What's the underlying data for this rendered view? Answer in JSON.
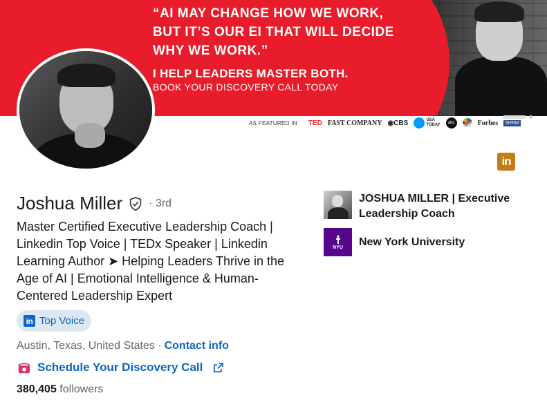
{
  "banner": {
    "quote_lines": [
      "“AI MAY CHANGE HOW WE WORK,",
      "BUT IT’S OUR EI THAT WILL DECIDE",
      "WHY WE WORK.”"
    ],
    "pitch": "I HELP LEADERS MASTER BOTH.",
    "cta": "BOOK YOUR DISCOVERY CALL TODAY",
    "featured_label": "AS FEATURED IN",
    "logos": {
      "ted": "TED",
      "fast_company": "FAST COMPANY",
      "cbs": "CBS",
      "usa_today_line1": "USA",
      "usa_today_line2": "TODAY",
      "abc": "abc",
      "nbc": "NBC",
      "forbes": "Forbes",
      "shrm": "SHRM"
    },
    "colors": {
      "background": "#e81c2a",
      "text": "#ffffff"
    }
  },
  "profile": {
    "name": "Joshua Miller",
    "verified_icon": "shield-check-icon",
    "degree": "· 3rd",
    "headline": "Master Certified Executive Leadership Coach | Linkedin Top Voice | TEDx Speaker | Linkedin Learning Author ➤ Helping Leaders Thrive in the Age of AI | Emotional Intelligence & Human-Centered Leadership Expert",
    "top_voice": {
      "icon_text": "in",
      "label": "Top Voice"
    },
    "location": "Austin, Texas, United States ·",
    "contact_info": "Contact info",
    "schedule_link": "Schedule Your Discovery Call",
    "followers_count": "380,405",
    "followers_label": "followers",
    "premium_badge_text": "in"
  },
  "orgs": [
    {
      "name": "JOSHUA MILLER | Executive Leadership Coach",
      "logo": "profile-photo"
    },
    {
      "name": "New York University",
      "logo": "nyu-torch",
      "logo_text": "NYU"
    }
  ],
  "colors": {
    "link": "#0a66c2",
    "premium_gold": "#c37d16",
    "nyu_purple": "#57068c",
    "top_voice_bg": "#dde7f1"
  }
}
